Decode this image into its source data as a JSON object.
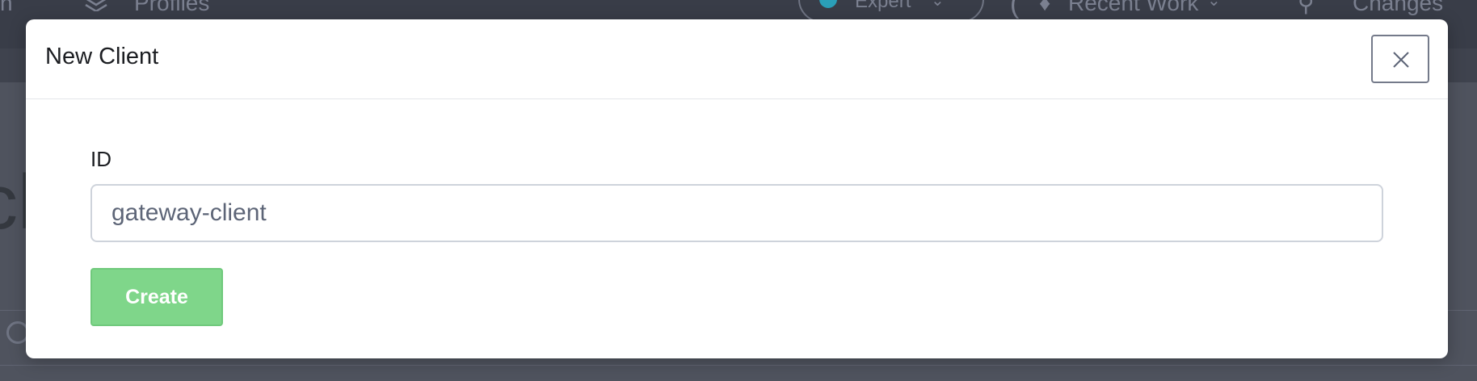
{
  "background": {
    "nav_left_fragment": "n",
    "nav_profiles": "Profiles",
    "expert_mode_label": "Expert",
    "expert_mode_chevron": "⌄",
    "recent_work_paren": "(",
    "recent_work_icon": "♦",
    "recent_work_label": "Recent Work",
    "recent_work_chevron": "⌄",
    "changes_icon": "⚲",
    "changes_label": "Changes",
    "page_heading_fragment": "cl"
  },
  "modal": {
    "title": "New Client",
    "close_icon": "close-icon",
    "form": {
      "id_label": "ID",
      "id_value": "gateway-client",
      "id_placeholder": ""
    },
    "create_label": "Create"
  },
  "colors": {
    "create_button": "#7fd68a",
    "overlay": "#4d515c",
    "modal_background": "#ffffff"
  }
}
